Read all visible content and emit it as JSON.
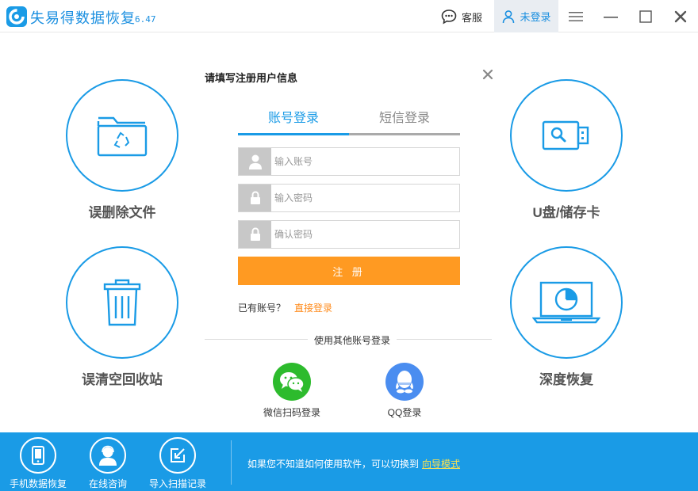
{
  "app": {
    "title": "失易得数据恢复",
    "version": "6.47"
  },
  "titlebar": {
    "service_label": "客服",
    "login_label": "未登录"
  },
  "features": [
    {
      "label": "误删除文件",
      "icon": "folder-recycle-icon"
    },
    {
      "label": "U盘/储存卡",
      "icon": "usb-drive-icon"
    },
    {
      "label": "误清空回收站",
      "icon": "trash-bin-icon"
    },
    {
      "label": "深度恢复",
      "icon": "laptop-disk-icon"
    }
  ],
  "dialog": {
    "title": "请填写注册用户信息",
    "tabs": [
      {
        "label": "账号登录",
        "active": true
      },
      {
        "label": "短信登录",
        "active": false
      }
    ],
    "fields": {
      "account_placeholder": "输入账号",
      "password_placeholder": "输入密码",
      "confirm_placeholder": "确认密码"
    },
    "register_label": "注 册",
    "have_account": "已有账号？",
    "direct_login": "直接登录",
    "other_login": "使用其他账号登录",
    "social": [
      {
        "label": "微信扫码登录",
        "icon": "wechat-icon",
        "color": "#2dbb2d"
      },
      {
        "label": "QQ登录",
        "icon": "qq-icon",
        "color": "#4a8df0"
      }
    ]
  },
  "bottombar": {
    "items": [
      {
        "label": "手机数据恢复",
        "icon": "phone-icon"
      },
      {
        "label": "在线咨询",
        "icon": "support-agent-icon"
      },
      {
        "label": "导入扫描记录",
        "icon": "import-icon"
      }
    ],
    "tip": "如果您不知道如何使用软件，可以切换到",
    "guide_link": "向导模式"
  },
  "colors": {
    "accent": "#1a9be6",
    "orange": "#ff9a22",
    "link_orange": "#ff8a1a",
    "guide_yellow": "#ffe34d"
  }
}
